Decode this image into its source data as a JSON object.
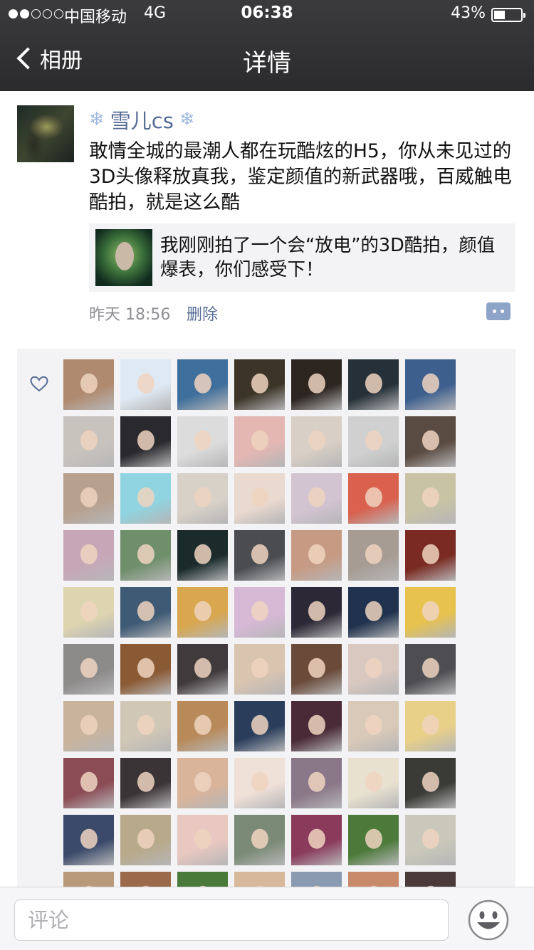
{
  "status_bar": {
    "signal_total": 5,
    "signal_filled": 2,
    "carrier": "中国移动",
    "network": "4G",
    "time": "06:38",
    "battery_text": "43%",
    "battery_level": 0.43
  },
  "nav": {
    "back_label": "相册",
    "title": "详情"
  },
  "post": {
    "author": "雪儿cs",
    "name_decoration": "❄",
    "text": "敢情全城的最潮人都在玩酷炫的H5，你从未见过的3D头像释放真我，鉴定颜值的新武器哦，百威触电酷拍，就是这么酷",
    "share_text": "我刚刚拍了一个会“放电”的3D酷拍，颜值爆表，你们感受下！",
    "time": "昨天 18:56",
    "delete_label": "删除"
  },
  "likes": {
    "avatar_colors": [
      "#b08a6e",
      "#dfe9f3",
      "#3f6f9c",
      "#3b3427",
      "#2d2520",
      "#263038",
      "#3d5f8e",
      "#c9c3bd",
      "#2a2a2e",
      "#dcdcdc",
      "#e4b7b3",
      "#d8cfc6",
      "#cfd0cf",
      "#5a4b42",
      "#b7a08e",
      "#8fd4e0",
      "#d8d1c8",
      "#e9d9cf",
      "#d3c4d2",
      "#d9614e",
      "#c8c3a5",
      "#c7a7b7",
      "#6f8e6a",
      "#1b2b2c",
      "#4a4c50",
      "#c69a83",
      "#a69c94",
      "#7a2a22",
      "#ddd4b0",
      "#3e5a74",
      "#d8a74e",
      "#d7b9d6",
      "#2d2836",
      "#20324d",
      "#e7c24e",
      "#8d8a8a",
      "#8a5a34",
      "#403a3c",
      "#d9c4b0",
      "#6a4b3a",
      "#d8c8c0",
      "#4e4e52",
      "#c9b39c",
      "#d0c7b6",
      "#b88a5a",
      "#2a3e5c",
      "#4a2a36",
      "#d9c9b8",
      "#e8d088",
      "#8c4c56",
      "#3b3436",
      "#d9b49a",
      "#efe0d8",
      "#8a7788",
      "#e8e1d0",
      "#3a3a36",
      "#3b4a6a",
      "#b8a98a",
      "#e8c8c0",
      "#7a8a76",
      "#8a3a5a",
      "#4c7a3a",
      "#c9c8ba",
      "#b89a7a",
      "#9a6a4a",
      "#4a7a3a",
      "#d8b89a",
      "#8a9ab0",
      "#c88a6a",
      "#4a3a3a"
    ]
  },
  "input": {
    "placeholder": "评论"
  },
  "colors": {
    "name_link": "#576b95",
    "header_bg": "#333335",
    "panel_bg": "#f3f3f5"
  },
  "icons": {
    "back": "chevron-left-icon",
    "like": "heart-icon",
    "comment": "comment-icon",
    "emoji": "smiley-icon"
  }
}
